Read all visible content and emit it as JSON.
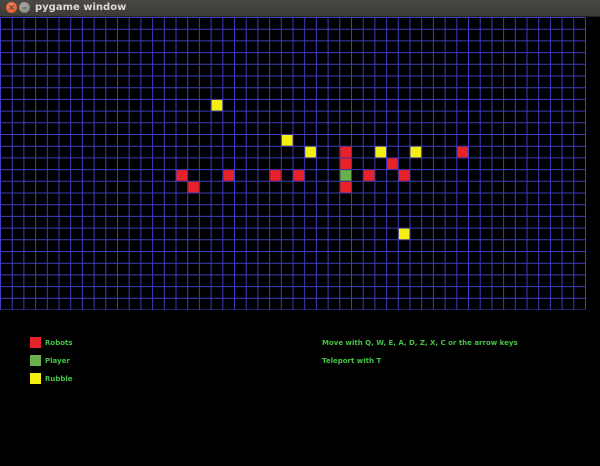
{
  "window": {
    "title": "pygame window",
    "close_glyph": "×",
    "minimize_glyph": "–"
  },
  "colors": {
    "grid_line": "#3d3dbd",
    "robot": "#e8222b",
    "player": "#6ab04c",
    "rubble": "#f4ee11",
    "text": "#46c246",
    "background": "#000000"
  },
  "board": {
    "columns": 50,
    "rows": 25,
    "robots": [
      [
        15,
        13
      ],
      [
        16,
        14
      ],
      [
        19,
        13
      ],
      [
        23,
        13
      ],
      [
        25,
        13
      ],
      [
        29,
        11
      ],
      [
        29,
        12
      ],
      [
        29,
        14
      ],
      [
        31,
        13
      ],
      [
        33,
        12
      ],
      [
        34,
        13
      ],
      [
        39,
        11
      ]
    ],
    "player": [
      [
        29,
        13
      ]
    ],
    "rubble": [
      [
        18,
        7
      ],
      [
        24,
        10
      ],
      [
        26,
        11
      ],
      [
        32,
        11
      ],
      [
        35,
        11
      ],
      [
        34,
        18
      ]
    ]
  },
  "legend": {
    "robots": "Robots",
    "player": "Player",
    "rubble": "Rubble"
  },
  "help": {
    "move": "Move with Q, W, E, A, D, Z, X, C or the arrow keys",
    "teleport": "Teleport with T"
  }
}
